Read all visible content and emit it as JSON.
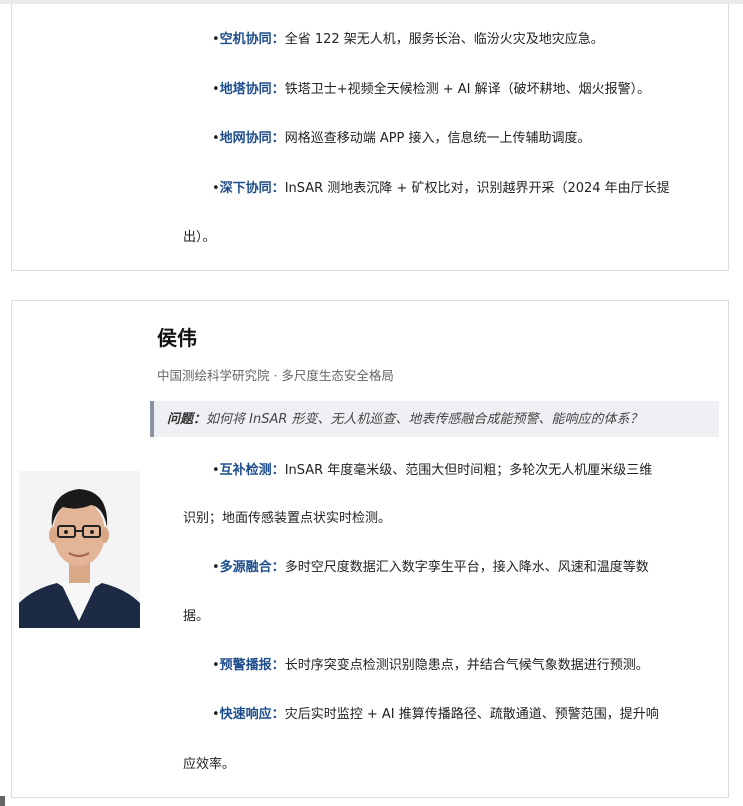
{
  "card1": {
    "items": [
      {
        "dot": "•",
        "head": "空机协同：",
        "body": "全省 122 架无人机，服务长治、临汾火灾及地灾应急。"
      },
      {
        "dot": "•",
        "head": "地塔协同：",
        "body": "铁塔卫士+视频全天候检测 + AI 解译（破坏耕地、烟火报警）。"
      },
      {
        "dot": "•",
        "head": "地网协同：",
        "body": "网格巡查移动端 APP 接入，信息统一上传辅助调度。"
      },
      {
        "dot": "•",
        "head": "深下协同：",
        "body": "InSAR 测地表沉降 + 矿权比对，识别越界开采（2024 年由厅长提",
        "cont": "出）。"
      }
    ]
  },
  "card2": {
    "name": "侯伟",
    "affiliation": "中国测绘科学研究院 · 多尺度生态安全格局",
    "question_label": "问题：",
    "question_text": "如何将 InSAR 形变、无人机巡查、地表传感融合成能预警、能响应的体系？",
    "items": [
      {
        "dot": "•",
        "head": "互补检测：",
        "body": "InSAR  年度毫米级、范围大但时间粗；多轮次无人机厘米级三维",
        "cont": "识别；地面传感装置点状实时检测。"
      },
      {
        "dot": "•",
        "head": "多源融合：",
        "body": "多时空尺度数据汇入数字孪生平台，接入降水、风速和温度等数",
        "cont": "据。"
      },
      {
        "dot": "•",
        "head": "预警播报：",
        "body": "长时序突变点检测识别隐患点，并结合气候气象数据进行预测。"
      },
      {
        "dot": "•",
        "head": "快速响应：",
        "body": "灾后实时监控 + AI 推算传播路径、疏散通道、预警范围，提升响",
        "cont": "应效率。"
      }
    ]
  }
}
